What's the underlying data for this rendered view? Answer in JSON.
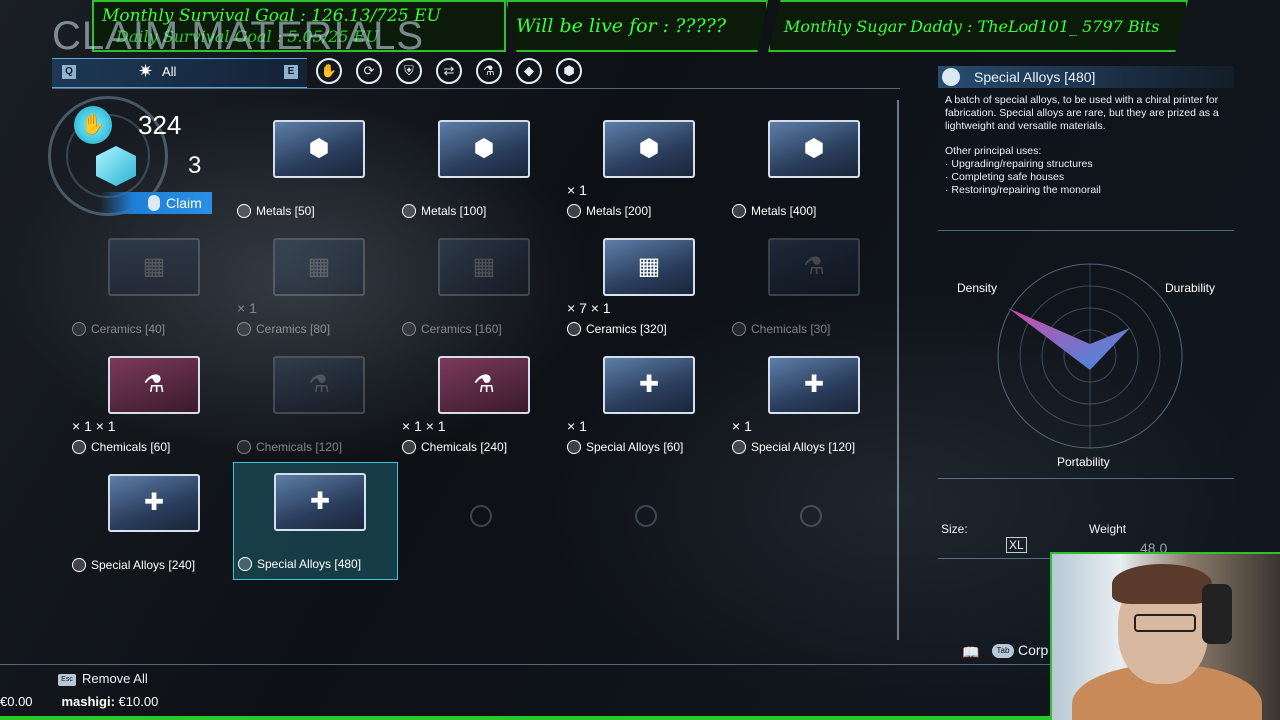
{
  "overlay": {
    "goal_monthly": "Monthly Survival Goal : 126.13/725 EU",
    "goal_daily": "Daily Survival Goal : 5.05/25 EU",
    "live": "Will be live for :   ?????",
    "sugar_daddy": "Monthly Sugar Daddy : TheLod101_ 5797 Bits"
  },
  "screen_title": "CLAIM MATERIALS",
  "filter": {
    "left_key": "Q",
    "right_key": "E",
    "selected": "All"
  },
  "categories": [
    "hand-icon",
    "refresh-icon",
    "shield-icon",
    "swap-icon",
    "flask-icon",
    "gem-icon",
    "hex-icon"
  ],
  "claim": {
    "amount_top": "324",
    "amount_bottom": "3",
    "button": "Claim"
  },
  "items": [
    {
      "label": "Metals [50]",
      "counts": "",
      "dim": false,
      "sym": "⬢"
    },
    {
      "label": "Metals [100]",
      "counts": "",
      "dim": false,
      "sym": "⬢"
    },
    {
      "label": "Metals [200]",
      "counts": "× 1",
      "dim": false,
      "sym": "⬢"
    },
    {
      "label": "Metals [400]",
      "counts": "",
      "dim": false,
      "sym": "⬢"
    },
    {
      "label": "Ceramics [40]",
      "counts": "",
      "dim": true,
      "sym": "▦"
    },
    {
      "label": "Ceramics [80]",
      "counts": "× 1",
      "dim": true,
      "sym": "▦"
    },
    {
      "label": "Ceramics [160]",
      "counts": "",
      "dim": true,
      "sym": "▦"
    },
    {
      "label": "Ceramics [320]",
      "counts": "× 7   × 1",
      "dim": false,
      "sym": "▦"
    },
    {
      "label": "Chemicals [30]",
      "counts": "",
      "dim": true,
      "sym": "⚗"
    },
    {
      "label": "Chemicals [60]",
      "counts": "× 1   × 1",
      "dim": false,
      "sym": "⚗"
    },
    {
      "label": "Chemicals [120]",
      "counts": "",
      "dim": true,
      "sym": "⚗"
    },
    {
      "label": "Chemicals [240]",
      "counts": "× 1   × 1",
      "dim": false,
      "sym": "⚗"
    },
    {
      "label": "Special Alloys [60]",
      "counts": "× 1",
      "dim": false,
      "sym": "✚"
    },
    {
      "label": "Special Alloys [120]",
      "counts": "× 1",
      "dim": false,
      "sym": "✚"
    },
    {
      "label": "Special Alloys [240]",
      "counts": "",
      "dim": false,
      "sym": "✚"
    },
    {
      "label": "Special Alloys [480]",
      "counts": "",
      "dim": false,
      "sym": "✚"
    }
  ],
  "detail": {
    "title": "Special Alloys [480]",
    "description": "A batch of special alloys, to be used with a chiral printer for fabrication. Special alloys are rare, but they are prized as a lightweight and versatile materials.",
    "uses_heading": "Other principal uses:",
    "uses": [
      "· Upgrading/repairing structures",
      "· Completing safe houses",
      "· Restoring/repairing the monorail"
    ],
    "radar": {
      "density": "Density",
      "durability": "Durability",
      "portability": "Portability"
    },
    "size_label": "Size:",
    "size_value": "XL",
    "weight_label": "Weight",
    "weight_value": "48.0",
    "corp": "Corp"
  },
  "bottom": {
    "remove_all": "Remove All",
    "donation_amount": "€0.00",
    "donor": "mashigi:",
    "donation": "€10.00"
  }
}
